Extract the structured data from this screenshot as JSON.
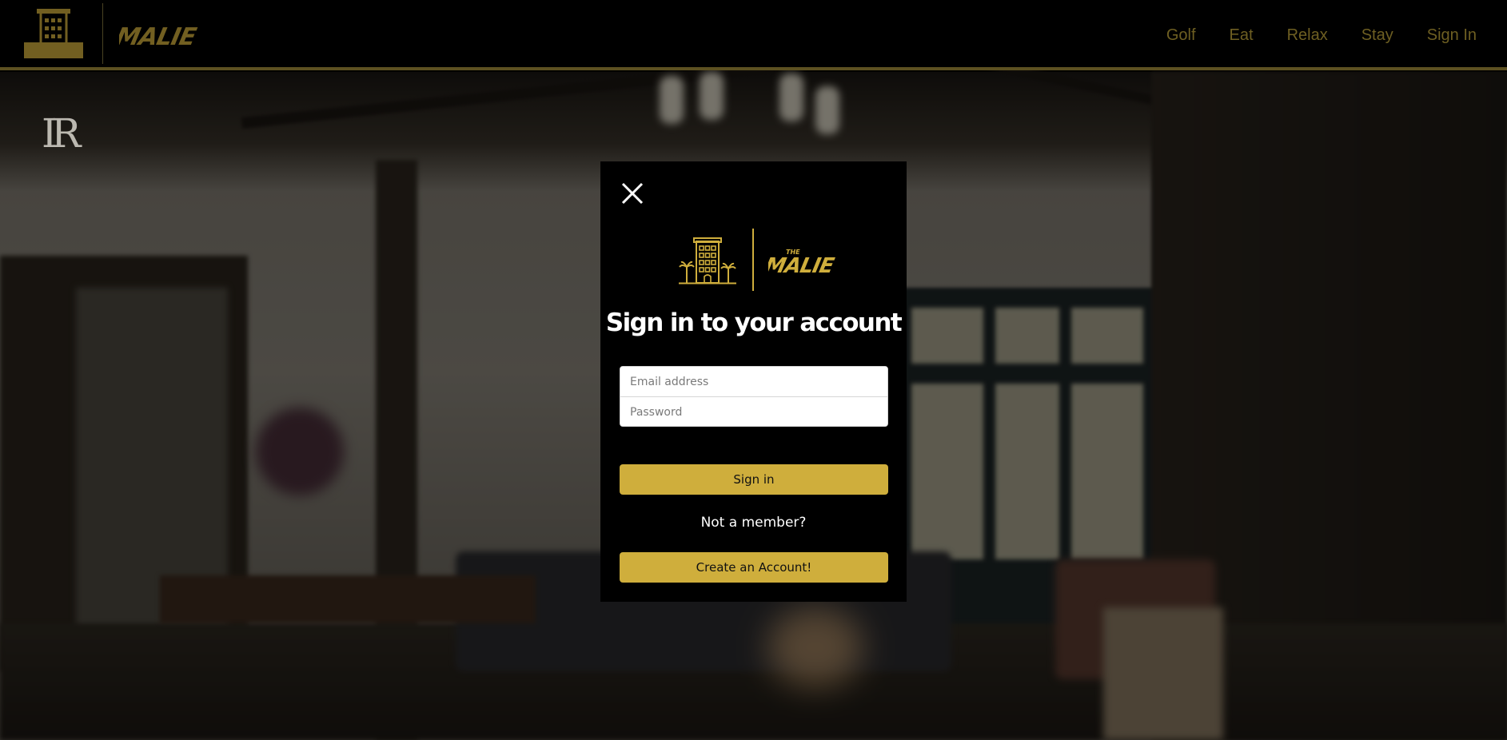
{
  "header": {
    "logo_alt": "The Malie",
    "nav": [
      {
        "label": "Golf"
      },
      {
        "label": "Eat"
      },
      {
        "label": "Relax"
      },
      {
        "label": "Stay"
      },
      {
        "label": "Sign In"
      }
    ]
  },
  "modal": {
    "title": "Sign in to your account",
    "email": {
      "placeholder": "Email address",
      "value": ""
    },
    "password": {
      "placeholder": "Password",
      "value": ""
    },
    "signin_label": "Sign in",
    "not_member_text": "Not a member?",
    "create_label": "Create an Account!"
  },
  "icons": {
    "close": "close-icon",
    "hotel": "hotel-building-icon"
  },
  "colors": {
    "accent": "#cfae3c",
    "header_border": "#5d5121",
    "modal_bg": "#000000",
    "nav_text": "#6e5f22"
  }
}
